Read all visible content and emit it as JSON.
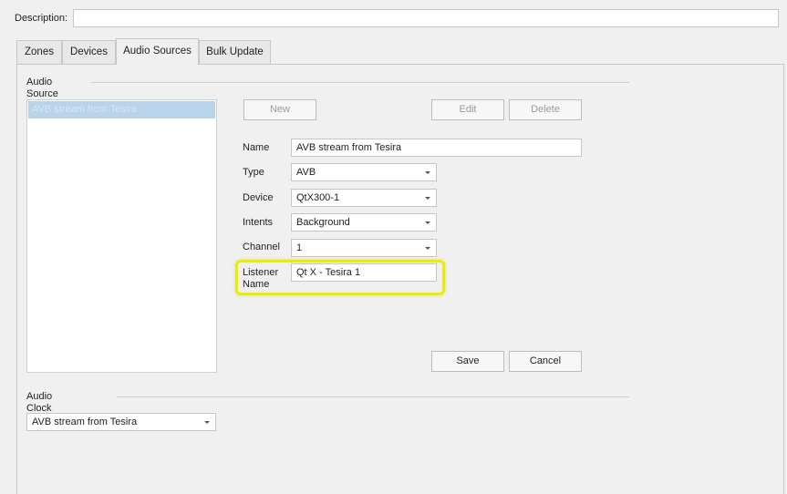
{
  "description": {
    "label": "Description:",
    "value": ""
  },
  "tabs": [
    {
      "label": "Zones"
    },
    {
      "label": "Devices"
    },
    {
      "label": "Audio Sources"
    },
    {
      "label": "Bulk Update"
    }
  ],
  "audio_source": {
    "group_title": "Audio Source",
    "list_items": [
      "AVB stream from Tesira"
    ],
    "buttons": {
      "new": "New",
      "edit": "Edit",
      "delete": "Delete",
      "save": "Save",
      "cancel": "Cancel"
    },
    "fields": {
      "name": {
        "label": "Name",
        "value": "AVB stream from Tesira"
      },
      "type": {
        "label": "Type",
        "value": "AVB"
      },
      "device": {
        "label": "Device",
        "value": "QtX300-1"
      },
      "intents": {
        "label": "Intents",
        "value": "Background"
      },
      "channel": {
        "label": "Channel",
        "value": "1"
      },
      "listener_name": {
        "label_line1": "Listener",
        "label_line2": "Name",
        "value": "Qt X - Tesira 1"
      }
    }
  },
  "audio_clock": {
    "group_title": "Audio Clock Source",
    "selected": "AVB stream from Tesira"
  },
  "colors": {
    "highlight": "#e8ee00",
    "selection": "#b8d3ea"
  }
}
